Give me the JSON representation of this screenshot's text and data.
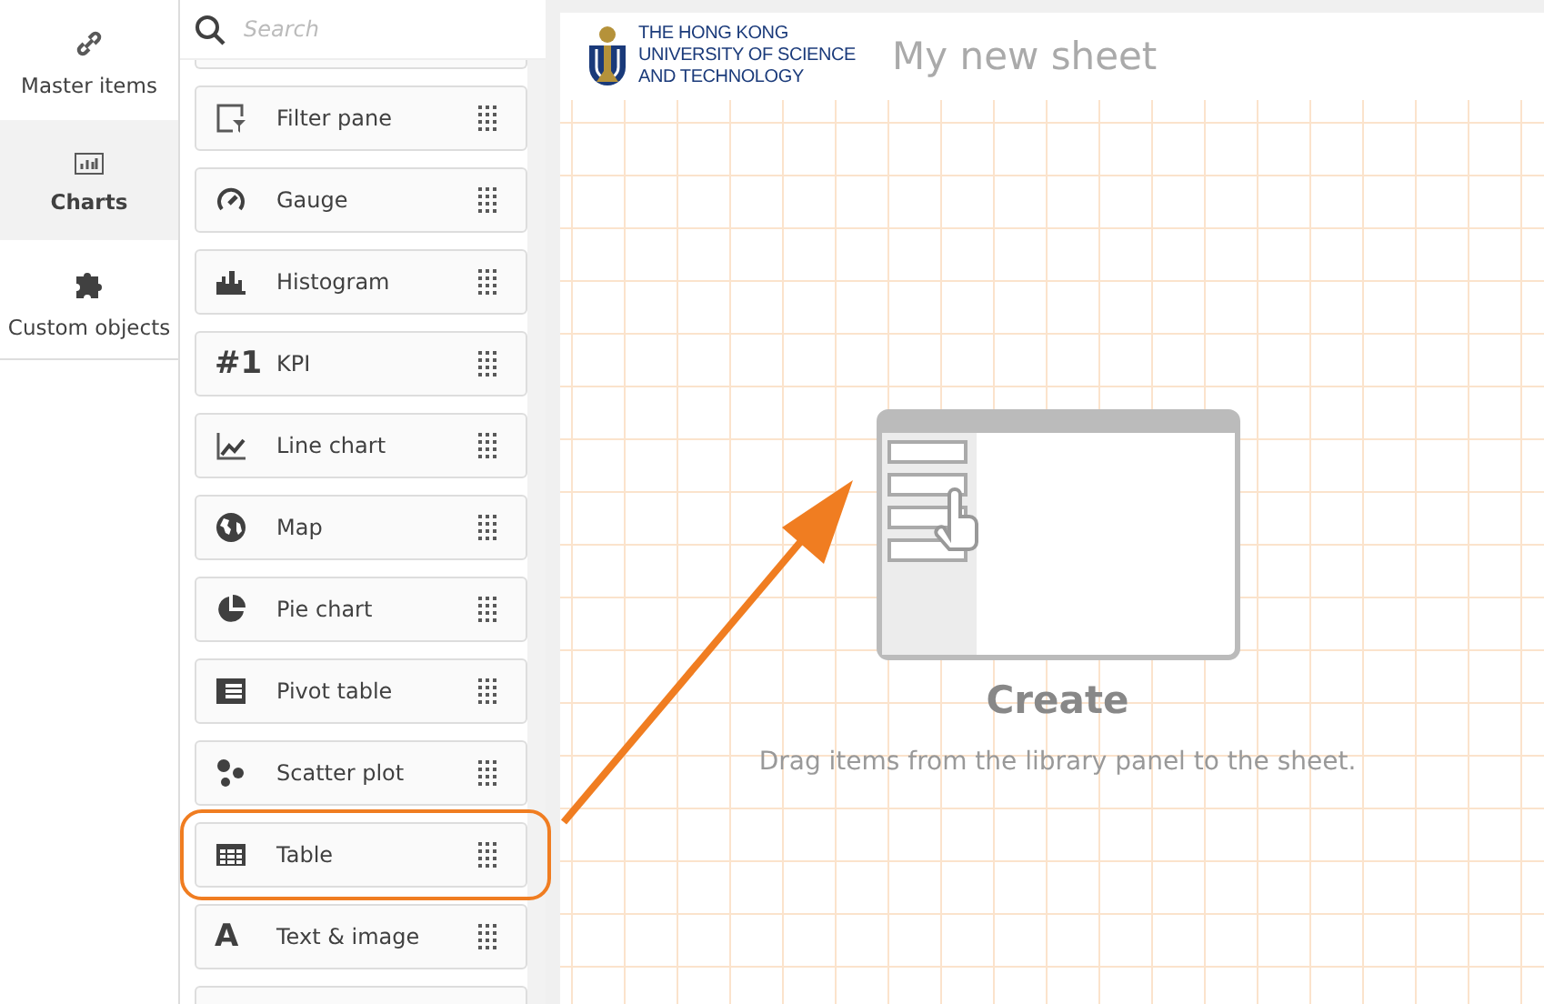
{
  "nav": [
    {
      "kind": "link",
      "label": "Master items",
      "selected": false
    },
    {
      "kind": "chart",
      "label": "Charts",
      "selected": true
    },
    {
      "kind": "puzzle",
      "label": "Custom objects",
      "selected": false
    }
  ],
  "search": {
    "placeholder": "Search"
  },
  "items": [
    {
      "kind": "filter",
      "label": "Filter pane",
      "highlighted": false
    },
    {
      "kind": "gauge",
      "label": "Gauge",
      "highlighted": false
    },
    {
      "kind": "histogram",
      "label": "Histogram",
      "highlighted": false
    },
    {
      "kind": "kpi",
      "icon_text": "#1",
      "label": "KPI",
      "highlighted": false
    },
    {
      "kind": "line",
      "label": "Line chart",
      "highlighted": false
    },
    {
      "kind": "map",
      "label": "Map",
      "highlighted": false
    },
    {
      "kind": "pie",
      "label": "Pie chart",
      "highlighted": false
    },
    {
      "kind": "pivot",
      "label": "Pivot table",
      "highlighted": false
    },
    {
      "kind": "scatter",
      "label": "Scatter plot",
      "highlighted": false
    },
    {
      "kind": "table",
      "label": "Table",
      "highlighted": true
    },
    {
      "kind": "text",
      "icon_text": "A",
      "label": "Text & image",
      "highlighted": false
    }
  ],
  "sheet": {
    "logo_lines": [
      "THE HONG KONG",
      "UNIVERSITY OF SCIENCE",
      "AND TECHNOLOGY"
    ],
    "title": "My new sheet",
    "empty_title": "Create",
    "empty_text": "Drag items from the library panel to the sheet."
  }
}
